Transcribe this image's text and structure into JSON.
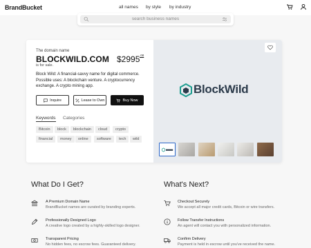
{
  "header": {
    "logo": "BrandBucket",
    "nav": [
      "all names",
      "by style",
      "by industry"
    ],
    "icons": [
      "cart-icon",
      "user-icon"
    ]
  },
  "search": {
    "placeholder": "search business names"
  },
  "listing": {
    "label": "The domain name",
    "domain": "BLOCKWILD.COM",
    "price": "$2995",
    "price_cents": ".00",
    "for_sale": "is for sale.",
    "description": "Block Wild: A financial-savvy name for digital commerce. Possible uses: A blockchain venture. A cryptocurrency exchange. A crypto mining app.",
    "buttons": {
      "inquire": "Inquire",
      "lease": "Lease to Own",
      "buy": "Buy Now"
    },
    "tabs": [
      "Keywords",
      "Categories"
    ],
    "keywords_row1": [
      "Bitcoin",
      "block",
      "blockchain",
      "cloud",
      "crypto"
    ],
    "keywords_row2": [
      "financial",
      "money",
      "online",
      "software",
      "tech",
      "wild"
    ],
    "brand_logo_text": "BlockWild",
    "brand_colors": {
      "hex": "#1e9d8f",
      "text": "#2b3a4a"
    }
  },
  "what_do_i_get": {
    "title": "What Do I Get?",
    "items": [
      {
        "icon": "bank-icon",
        "title": "A Premium Domain Name",
        "desc": "BrandBucket names are curated by branding experts."
      },
      {
        "icon": "pen-icon",
        "title": "Professionally Designed Logo",
        "desc": "A creative logo created by a highly-skilled logo designer."
      },
      {
        "icon": "money-icon",
        "title": "Transparent Pricing",
        "desc": "No hidden fees, no escrow fees. Guaranteed delivery."
      }
    ]
  },
  "whats_next": {
    "title": "What's Next?",
    "items": [
      {
        "icon": "cart-icon",
        "title": "Checkout Securely",
        "desc": "We accept all major credit cards, Bitcoin or wire transfers."
      },
      {
        "icon": "info-icon",
        "title": "Follow Transfer Instructions",
        "desc": "An agent will contact you with personalized information."
      },
      {
        "icon": "truck-icon",
        "title": "Confirm Delivery",
        "desc": "Payment is held in escrow until you've received the name."
      }
    ]
  }
}
